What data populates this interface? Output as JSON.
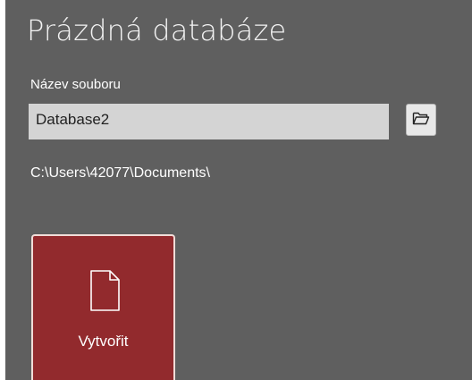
{
  "page": {
    "title": "Prázdná databáze"
  },
  "form": {
    "filename_label": "Název souboru",
    "filename_value": "Database2",
    "save_path": "C:\\Users\\42077\\Documents\\"
  },
  "icons": {
    "browse": "open-folder-icon",
    "create": "blank-document-icon"
  },
  "actions": {
    "create_label": "Vytvořit"
  },
  "colors": {
    "panel_background": "#5f5f5f",
    "input_background": "#d4d4d4",
    "create_button_background": "#922a2d",
    "create_button_border": "#f1dcd8"
  }
}
